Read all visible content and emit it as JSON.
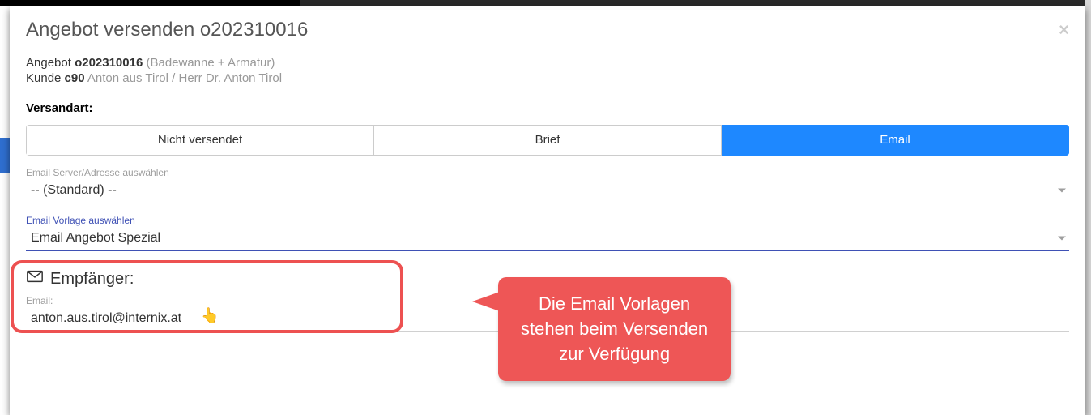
{
  "modal": {
    "title": "Angebot versenden o202310016"
  },
  "summary": {
    "offer_label": "Angebot",
    "offer_no": "o202310016",
    "offer_desc": "(Badewanne + Armatur)",
    "customer_label": "Kunde",
    "customer_no": "c90",
    "customer_name": "Anton aus Tirol / Herr Dr. Anton Tirol"
  },
  "shipping": {
    "label": "Versandart:",
    "options": {
      "not_sent": "Nicht versendet",
      "letter": "Brief",
      "email": "Email"
    }
  },
  "server_select": {
    "label": "Email Server/Adresse auswählen",
    "value": "-- (Standard) --"
  },
  "template_select": {
    "label": "Email Vorlage auswählen",
    "value": "Email Angebot Spezial"
  },
  "recipients": {
    "heading": "Empfänger:",
    "email_label": "Email:",
    "email_value": "anton.aus.tirol@internix.at"
  },
  "callout": {
    "line1": "Die Email Vorlagen",
    "line2": "stehen beim Versenden",
    "line3": "zur Verfügung"
  }
}
